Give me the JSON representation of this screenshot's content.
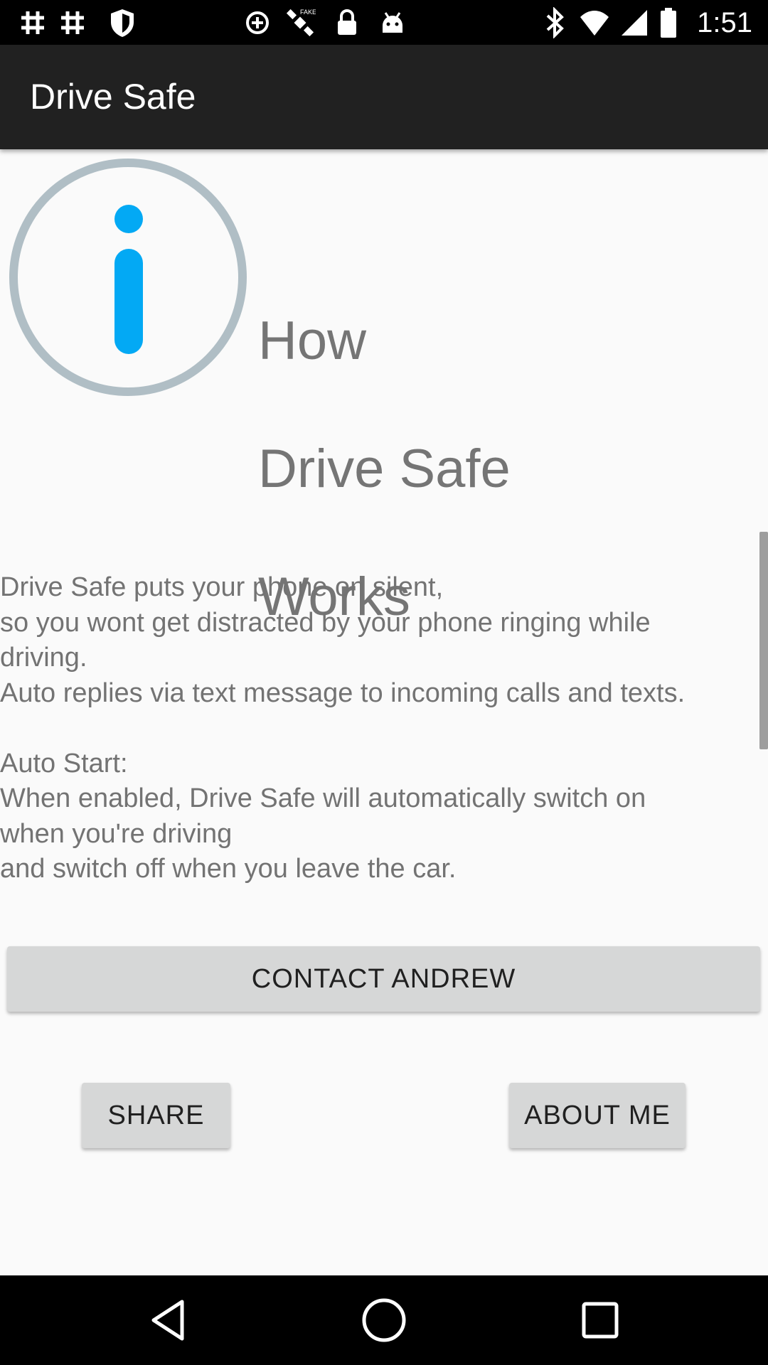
{
  "status_bar": {
    "time": "1:51",
    "left_icons": [
      "hash-icon",
      "hash-icon",
      "shield-icon",
      "data-saver-icon",
      "satellite-icon",
      "lock-icon",
      "android-icon"
    ],
    "right_icons": [
      "bluetooth-icon",
      "wifi-icon",
      "signal-icon",
      "battery-icon"
    ]
  },
  "toolbar": {
    "title": "Drive Safe"
  },
  "info": {
    "icon": "info-icon",
    "ring_color": "#b0bec5",
    "accent_color": "#03a9f4",
    "heading_lines": [
      "How",
      "Drive Safe",
      "Works"
    ]
  },
  "description": {
    "paragraph1": [
      "Drive Safe puts your phone on silent,",
      "so you wont get distracted by your phone ringing while",
      "driving.",
      "Auto replies via text message to incoming calls and texts."
    ],
    "paragraph2": [
      "Auto Start:",
      "When enabled, Drive Safe will automatically switch on",
      "when you're driving",
      "and switch off when you leave the car."
    ]
  },
  "buttons": {
    "contact": "CONTACT ANDREW",
    "share": "SHARE",
    "about": "ABOUT ME"
  },
  "nav_bar": {
    "icons": [
      "back-icon",
      "home-icon",
      "recents-icon"
    ]
  }
}
